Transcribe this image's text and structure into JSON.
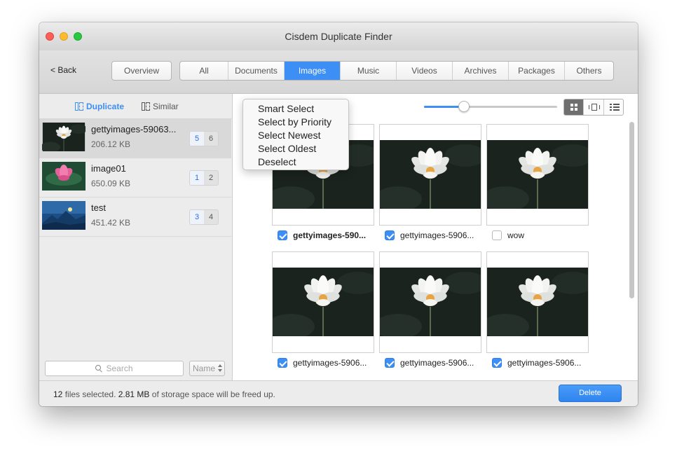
{
  "window": {
    "title": "Cisdem Duplicate Finder"
  },
  "toolbar": {
    "back_label": "< Back",
    "overview_label": "Overview",
    "categories": [
      "All",
      "Documents",
      "Images",
      "Music",
      "Videos",
      "Archives",
      "Packages",
      "Others"
    ],
    "active_category": "Images"
  },
  "sidebar": {
    "tabs": {
      "duplicate": "Duplicate",
      "similar": "Similar"
    },
    "items": [
      {
        "name": "gettyimages-59063...",
        "size": "206.12 KB",
        "count_a": "5",
        "count_b": "6",
        "selected": true
      },
      {
        "name": "image01",
        "size": "650.09 KB",
        "count_a": "1",
        "count_b": "2",
        "selected": false
      },
      {
        "name": "test",
        "size": "451.42 KB",
        "count_a": "3",
        "count_b": "4",
        "selected": false
      }
    ],
    "search_placeholder": "Search",
    "sort_label": "Name"
  },
  "select_menu": {
    "items": [
      "Smart Select",
      "Select by Priority",
      "Select Newest",
      "Select Oldest",
      "Deselect"
    ]
  },
  "content": {
    "zoom_level": 0.3,
    "view_modes": [
      "grid",
      "filmstrip",
      "list"
    ],
    "active_view": "grid",
    "files": [
      {
        "name": "gettyimages-590...",
        "checked": true,
        "bold": true
      },
      {
        "name": "gettyimages-5906...",
        "checked": true,
        "bold": false
      },
      {
        "name": "wow",
        "checked": false,
        "bold": false
      },
      {
        "name": "gettyimages-5906...",
        "checked": true,
        "bold": false
      },
      {
        "name": "gettyimages-5906...",
        "checked": true,
        "bold": false
      },
      {
        "name": "gettyimages-5906...",
        "checked": true,
        "bold": false
      }
    ]
  },
  "status": {
    "count": "12",
    "count_suffix": " files selected. ",
    "size": "2.81 MB",
    "size_suffix": " of storage space will be freed up.",
    "delete_label": "Delete"
  },
  "colors": {
    "accent": "#3d8ef5"
  }
}
